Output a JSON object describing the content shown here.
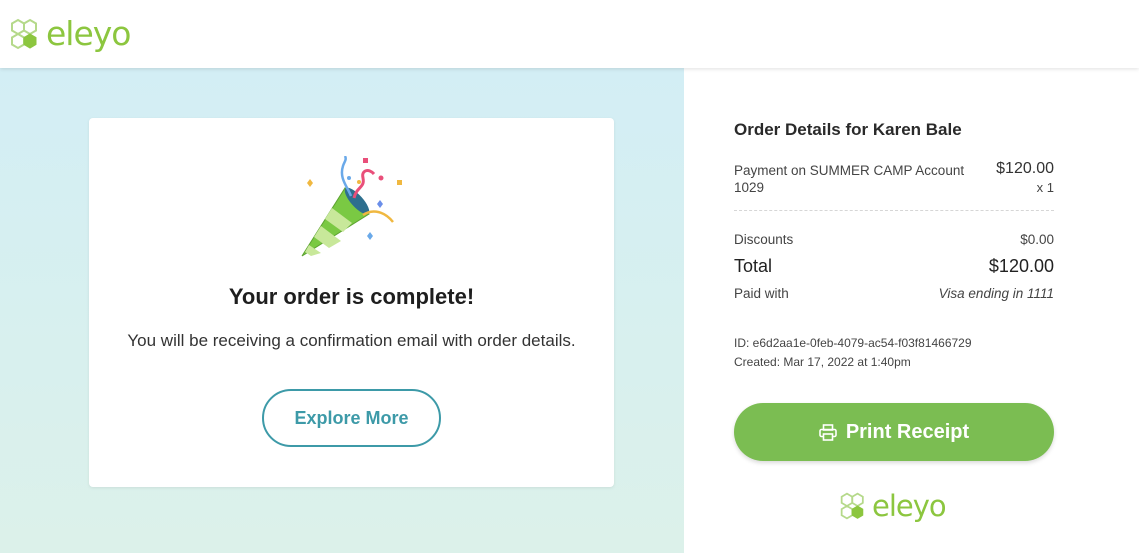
{
  "brand": {
    "name": "eleyo",
    "color": "#8cc63f"
  },
  "confirmation": {
    "icon": "party-popper-icon",
    "title": "Your order is complete!",
    "message": "You will be receiving a confirmation email with order details.",
    "explore_label": "Explore More"
  },
  "order": {
    "title": "Order Details for Karen Bale",
    "items": [
      {
        "description": "Payment on SUMMER CAMP Account 1029",
        "price": "$120.00",
        "quantity": "x 1"
      }
    ],
    "discounts_label": "Discounts",
    "discounts_value": "$0.00",
    "total_label": "Total",
    "total_value": "$120.00",
    "paid_with_label": "Paid with",
    "paid_with_value": "Visa ending in 1111",
    "id_text": "ID: e6d2aa1e-0feb-4079-ac54-f03f81466729",
    "created_text": "Created: Mar 17, 2022 at 1:40pm",
    "print_label": "Print Receipt",
    "print_icon": "printer-icon"
  },
  "colors": {
    "accent_green": "#7bbd52",
    "accent_teal": "#3d9aa8"
  }
}
